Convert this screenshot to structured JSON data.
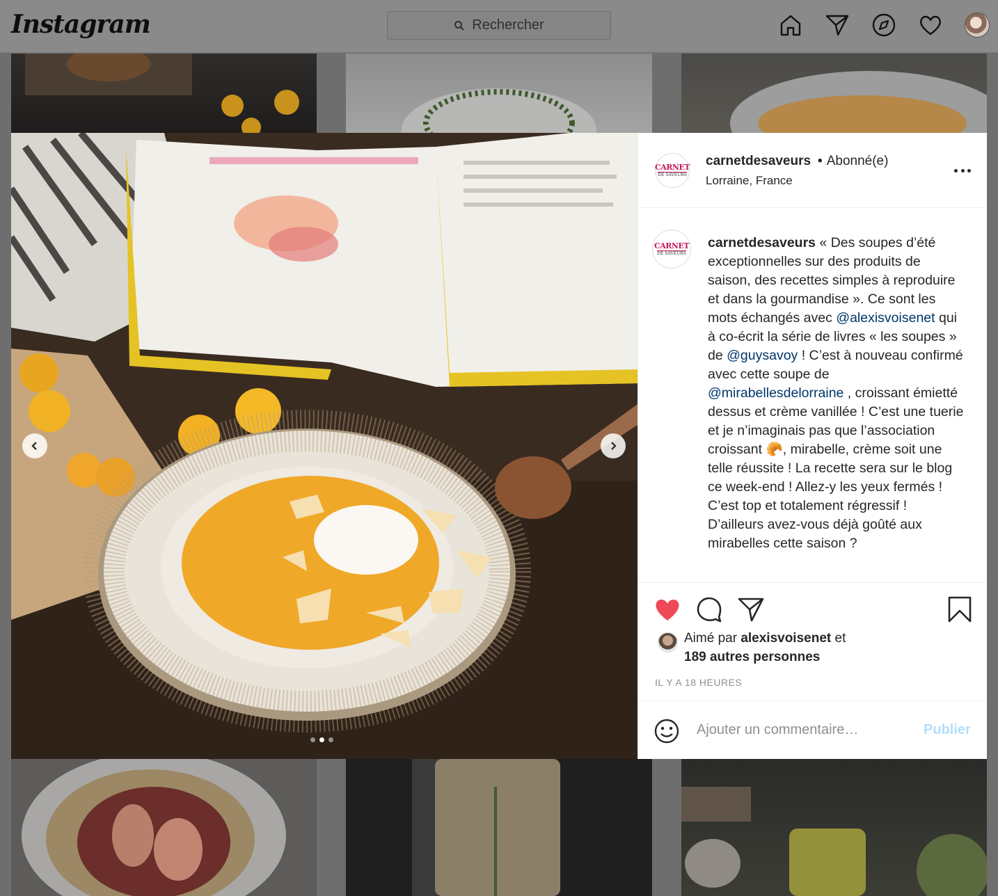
{
  "nav": {
    "logo": "Instagram",
    "search_placeholder": "Rechercher",
    "icons": [
      "home-icon",
      "direct-icon",
      "explore-icon",
      "activity-heart-icon",
      "profile-avatar"
    ]
  },
  "post": {
    "username": "carnetdesaveurs",
    "follow_status": "Abonné(e)",
    "location": "Lorraine, France",
    "avatar_text_top": "CARNET",
    "avatar_text_bottom": "DE SAVEURS",
    "caption": {
      "username": "carnetdesaveurs",
      "part1": " « Des soupes d’été exceptionnelles sur des produits de saison, des recettes simples à reproduire et dans la gourmandise ». Ce sont les mots échangés avec ",
      "mention1": "@alexisvoisenet",
      "part2": " qui à co-écrit la série de livres « les soupes » de ",
      "mention2": "@guysavoy",
      "part3": " ! C’est à nouveau confirmé avec cette soupe de ",
      "mention3": "@mirabellesdelorraine",
      "part4": " , croissant émietté dessus et crème vanillée ! C’est une tuerie et je n’imaginais pas que l’association croissant ",
      "emoji": "🥐",
      "part5": ", mirabelle, crème soit une telle réussite ! La recette sera sur le blog ce week-end ! Allez-y les yeux fermés ! C’est top et totalement régressif ! D’ailleurs avez-vous déjà goûté aux mirabelles cette saison ?"
    },
    "likes": {
      "prefix": "Aimé par ",
      "first_liker": "alexisvoisenet",
      "middle": " et",
      "others": "189 autres personnes"
    },
    "timestamp": "IL Y A 18 HEURES",
    "comment_placeholder": "Ajouter un commentaire…",
    "publish_label": "Publier",
    "carousel": {
      "total": 3,
      "active_index": 1
    },
    "liked": true,
    "colors": {
      "like": "#ed4956",
      "mention": "#00376b",
      "publish": "#b2dffc"
    }
  }
}
